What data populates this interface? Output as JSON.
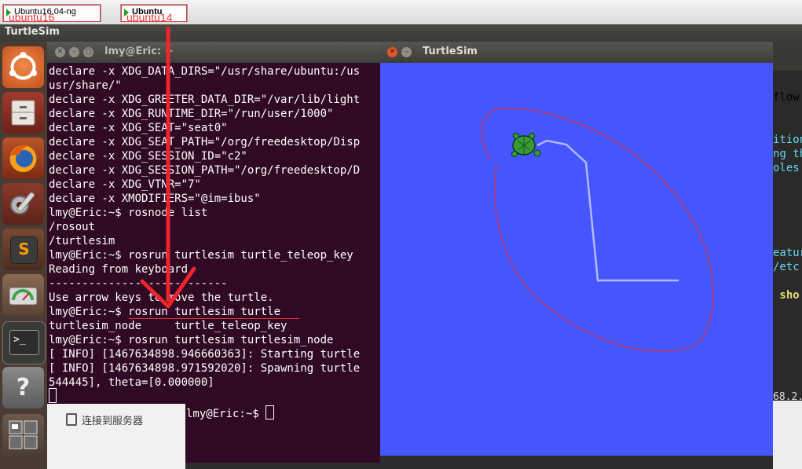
{
  "vm_tabs": [
    {
      "label": "Ubuntu16.04-ng",
      "annotation": "ubuntu16",
      "active": false
    },
    {
      "label": "Ubuntu",
      "annotation": "ubuntu14",
      "active": true
    }
  ],
  "topbar": {
    "app_title": "TurtleSim"
  },
  "launcher": {
    "items": [
      {
        "name": "dash-home",
        "icon": "ubuntu-logo-icon"
      },
      {
        "name": "files",
        "icon": "file-cabinet-icon"
      },
      {
        "name": "firefox",
        "icon": "firefox-icon"
      },
      {
        "name": "system-settings",
        "icon": "wrench-icon"
      },
      {
        "name": "sublime-text",
        "icon": "sublime-icon",
        "glyph": "S"
      },
      {
        "name": "disk-usage",
        "icon": "disk-icon"
      },
      {
        "name": "terminal",
        "icon": "terminal-icon",
        "glyph": ">_"
      },
      {
        "name": "help",
        "icon": "help-icon",
        "glyph": "?"
      },
      {
        "name": "workspaces",
        "icon": "workspace-switcher-icon"
      }
    ]
  },
  "terminal_main": {
    "title": "lmy@Eric: ~",
    "lines": [
      "declare -x XDG_DATA_DIRS=\"/usr/share/ubuntu:/us",
      "usr/share/\"",
      "declare -x XDG_GREETER_DATA_DIR=\"/var/lib/light",
      "declare -x XDG_RUNTIME_DIR=\"/run/user/1000\"",
      "declare -x XDG_SEAT=\"seat0\"",
      "declare -x XDG_SEAT_PATH=\"/org/freedesktop/Disp",
      "declare -x XDG_SESSION_ID=\"c2\"",
      "declare -x XDG_SESSION_PATH=\"/org/freedesktop/D",
      "declare -x XDG_VTNR=\"7\"",
      "declare -x XMODIFIERS=\"@im=ibus\"",
      "lmy@Eric:~$ rosnode list",
      "/rosout",
      "/turtlesim",
      "lmy@Eric:~$ rosrun turtlesim turtle_teleop_key",
      "Reading from keyboard",
      "---------------------------",
      "Use arrow keys to move the turtle.",
      "lmy@Eric:~$ rosrun turtlesim turtle",
      "turtlesim_node     turtle_teleop_key",
      "lmy@Eric:~$ rosrun turtlesim turtlesim_node",
      "[ INFO] [1467634898.946660363]: Starting turtle",
      "[ INFO] [1467634898.971592020]: Spawning turtle",
      "544445], theta=[0.000000]",
      ""
    ]
  },
  "nautilus": {
    "connect_to_server": "连接到服务器"
  },
  "terminal_second": {
    "prompt": "lmy@Eric:~$ "
  },
  "editor_fragments": [
    {
      "text": "flow",
      "color": "#8a8a8a"
    },
    {
      "text": "ition",
      "color": "#66d9ef"
    },
    {
      "text": "ng th",
      "color": "#66d9ef"
    },
    {
      "text": "oles",
      "color": "#66d9ef"
    },
    {
      "text": "eatur",
      "color": "#66d9ef"
    },
    {
      "text": "/etc",
      "color": "#66d9ef"
    },
    {
      "text": " sho",
      "color": "#e6db74"
    }
  ],
  "editor_bottom_fragment": "68.2.",
  "turtlesim": {
    "title": "TurtleSim",
    "background_color": "#4556ff",
    "trail_color": "#b3b8ff",
    "annotation_color": "#d9314b",
    "turtle_icon": "turtle-icon"
  },
  "annotation_arrow_color": "#f0242c"
}
